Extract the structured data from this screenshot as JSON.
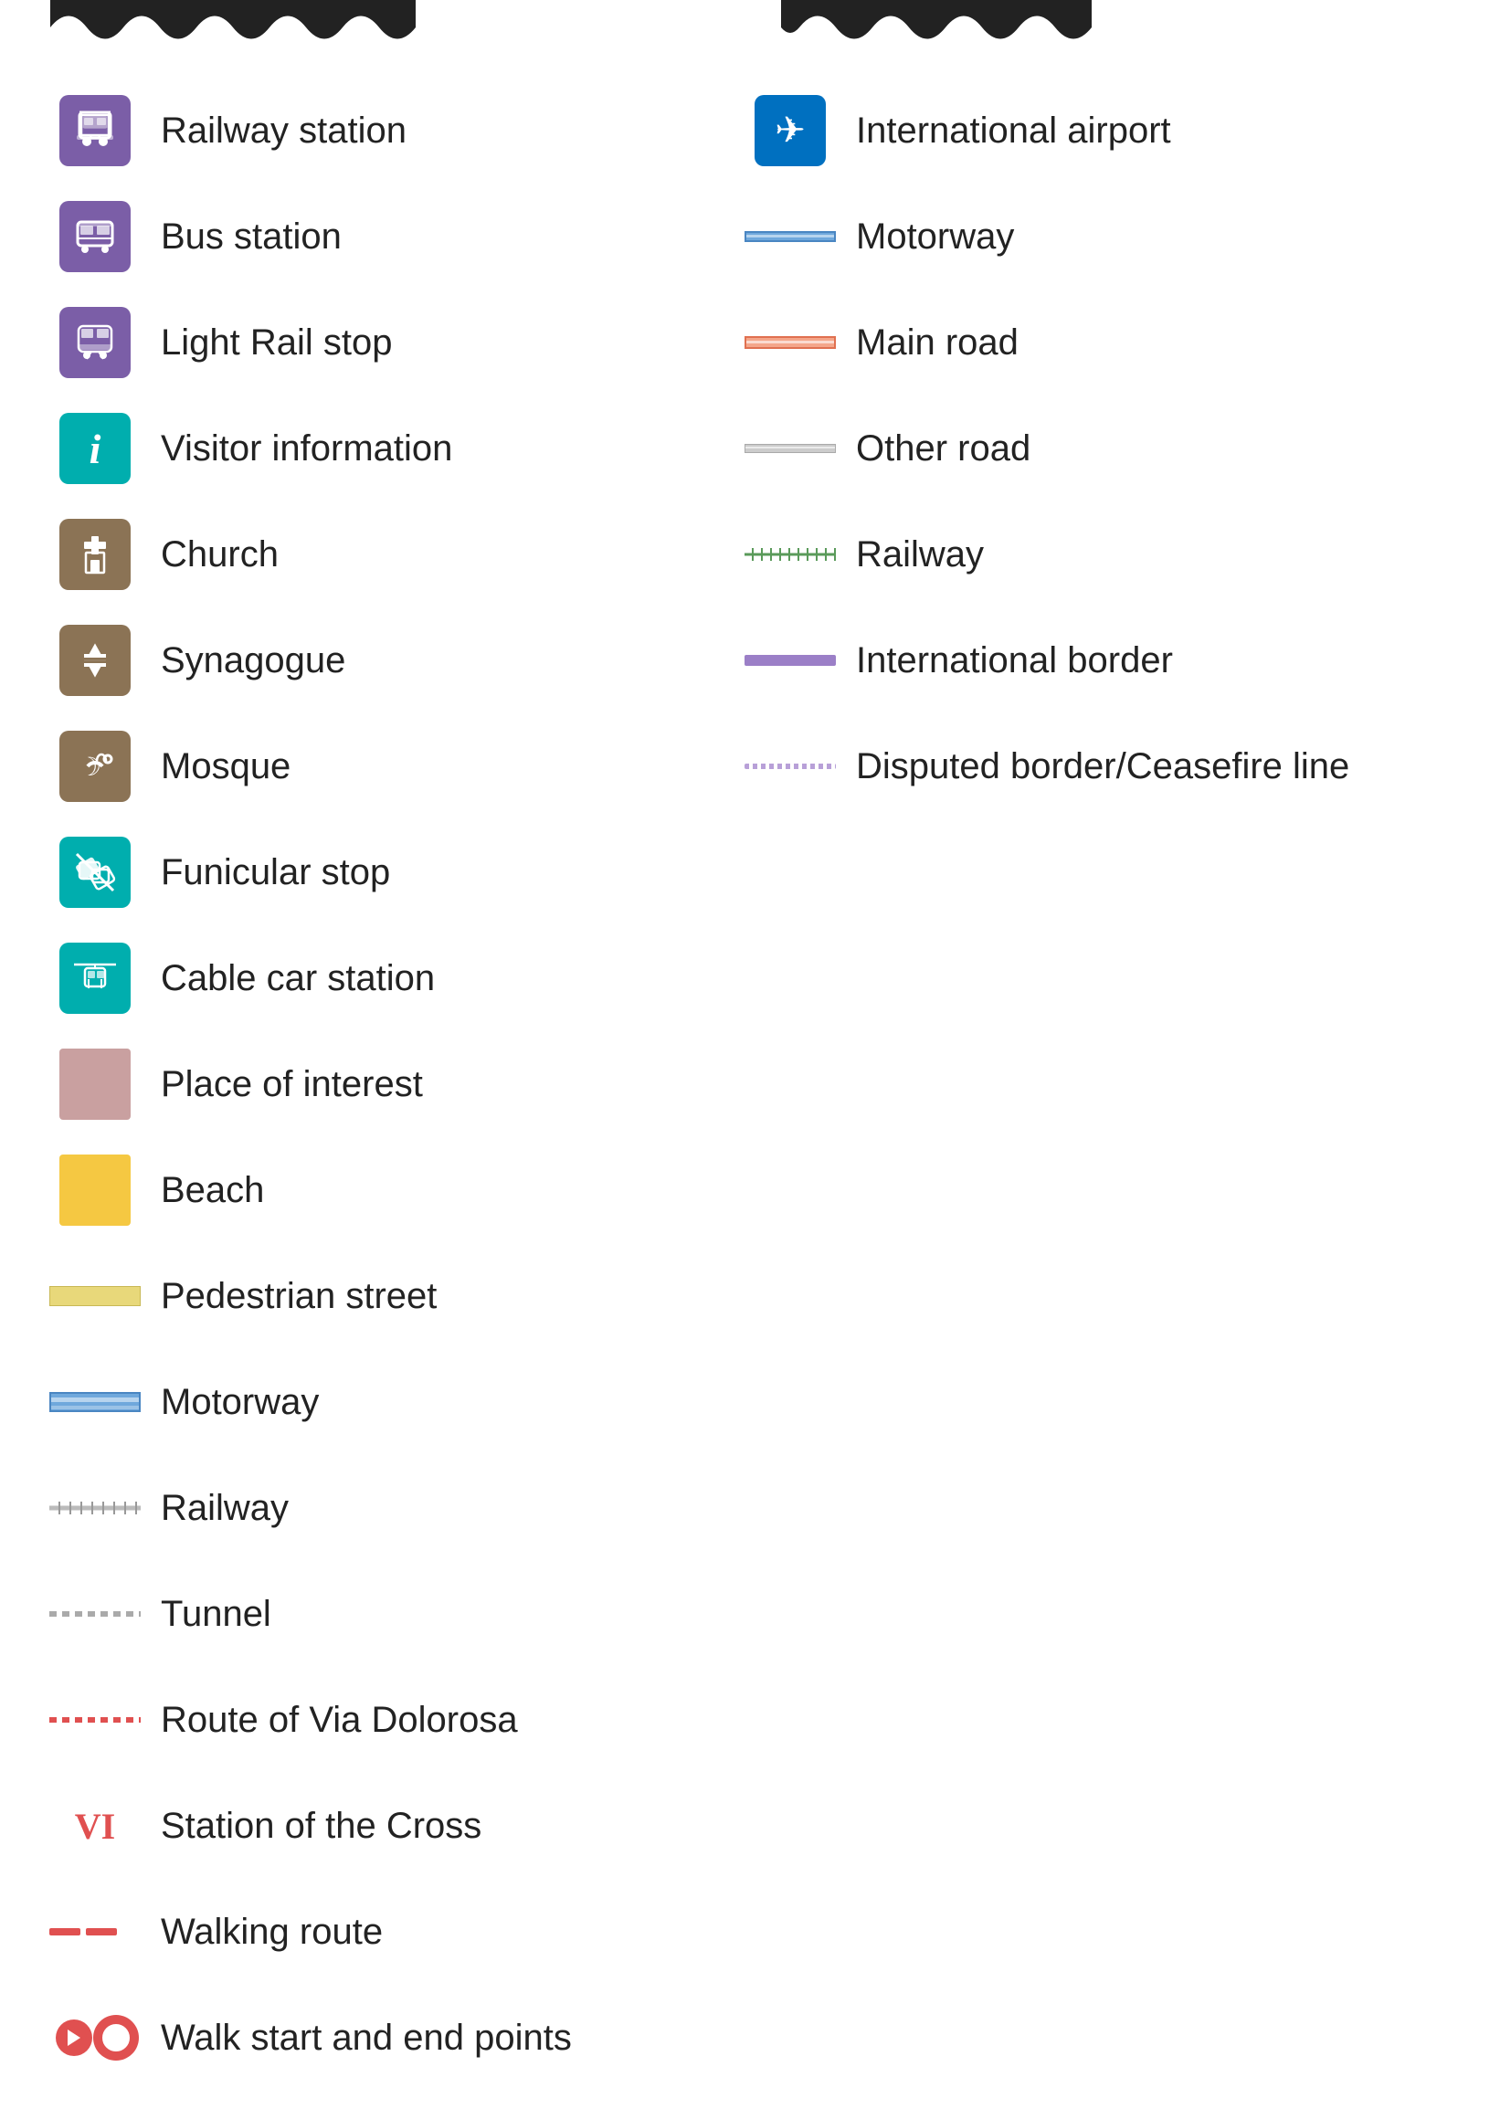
{
  "header": {
    "wavy1_width": 400,
    "wavy2_width": 330
  },
  "left_column": {
    "items": [
      {
        "id": "railway-station",
        "label": "Railway station",
        "icon_type": "purple-railway"
      },
      {
        "id": "bus-station",
        "label": "Bus station",
        "icon_type": "purple-bus"
      },
      {
        "id": "light-rail-stop",
        "label": "Light Rail stop",
        "icon_type": "purple-lightrail"
      },
      {
        "id": "visitor-information",
        "label": "Visitor information",
        "icon_type": "teal-info"
      },
      {
        "id": "church",
        "label": "Church",
        "icon_type": "brown-cross"
      },
      {
        "id": "synagogue",
        "label": "Synagogue",
        "icon_type": "brown-star"
      },
      {
        "id": "mosque",
        "label": "Mosque",
        "icon_type": "brown-crescent"
      },
      {
        "id": "funicular-stop",
        "label": "Funicular stop",
        "icon_type": "teal-funicular"
      },
      {
        "id": "cable-car-station",
        "label": "Cable car station",
        "icon_type": "teal-cablecar"
      },
      {
        "id": "place-of-interest",
        "label": "Place of interest",
        "icon_type": "poi-box"
      },
      {
        "id": "beach",
        "label": "Beach",
        "icon_type": "beach-box"
      },
      {
        "id": "pedestrian-street",
        "label": "Pedestrian street",
        "icon_type": "pedestrian-line"
      },
      {
        "id": "motorway-area",
        "label": "Motorway",
        "icon_type": "motorway-line-left"
      },
      {
        "id": "railway-area",
        "label": "Railway",
        "icon_type": "railway-line-left"
      },
      {
        "id": "tunnel",
        "label": "Tunnel",
        "icon_type": "tunnel-line"
      },
      {
        "id": "via-dolorosa",
        "label": "Route of Via Dolorosa",
        "icon_type": "via-dolorosa-line"
      },
      {
        "id": "station-cross",
        "label": "Station of the Cross",
        "icon_type": "station-cross",
        "cross_label": "VI"
      },
      {
        "id": "walking-route",
        "label": "Walking route",
        "icon_type": "walking-route"
      },
      {
        "id": "walk-points",
        "label": "Walk start and end points",
        "icon_type": "walk-points"
      }
    ]
  },
  "right_column": {
    "items": [
      {
        "id": "intl-airport",
        "label": "International airport",
        "icon_type": "blue-airport"
      },
      {
        "id": "motorway",
        "label": "Motorway",
        "icon_type": "motorway-line"
      },
      {
        "id": "main-road",
        "label": "Main road",
        "icon_type": "mainroad-line"
      },
      {
        "id": "other-road",
        "label": "Other road",
        "icon_type": "otherroad-line"
      },
      {
        "id": "railway",
        "label": "Railway",
        "icon_type": "railway-line"
      },
      {
        "id": "intl-border",
        "label": "International border",
        "icon_type": "intl-border-line"
      },
      {
        "id": "disputed-border",
        "label": "Disputed border/Ceasefire line",
        "icon_type": "disputed-line"
      }
    ]
  }
}
